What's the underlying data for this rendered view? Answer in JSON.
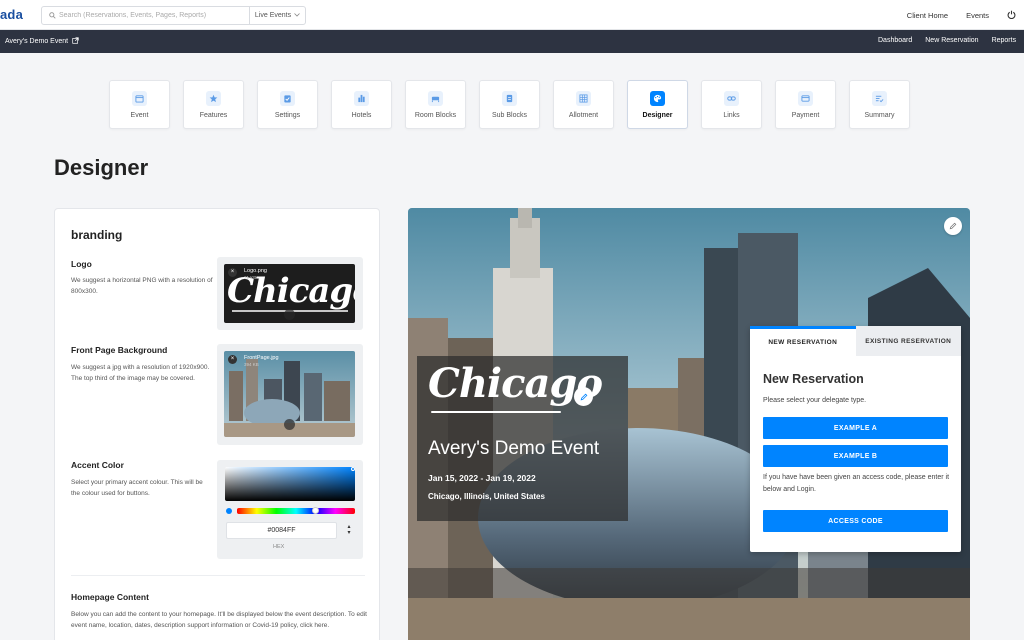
{
  "app": {
    "brand": "ada",
    "search_placeholder": "Search (Reservations, Events, Pages, Reports)",
    "search_scope": "Live Events",
    "top_links": [
      "Client Home",
      "Events"
    ]
  },
  "subbar": {
    "event_name": "Avery's Demo Event",
    "links": [
      "Dashboard",
      "New Reservation",
      "Reports"
    ]
  },
  "tabs": [
    {
      "label": "Event",
      "icon": "calendar-icon"
    },
    {
      "label": "Features",
      "icon": "star-icon"
    },
    {
      "label": "Settings",
      "icon": "clipboard-check-icon"
    },
    {
      "label": "Hotels",
      "icon": "building-icon"
    },
    {
      "label": "Room Blocks",
      "icon": "bed-icon"
    },
    {
      "label": "Sub Blocks",
      "icon": "document-icon"
    },
    {
      "label": "Allotment",
      "icon": "grid-icon"
    },
    {
      "label": "Designer",
      "icon": "palette-icon",
      "active": true
    },
    {
      "label": "Links",
      "icon": "link-icon"
    },
    {
      "label": "Payment",
      "icon": "credit-card-icon"
    },
    {
      "label": "Summary",
      "icon": "list-check-icon"
    }
  ],
  "page_title": "Designer",
  "branding": {
    "heading": "branding",
    "logo": {
      "title": "Logo",
      "desc": "We suggest a horizontal PNG with a resolution of 800x300.",
      "file_name": "Logo.png",
      "file_size": "21 KB"
    },
    "background": {
      "title": "Front Page Background",
      "desc": "We suggest a jpg with a resolution of 1920x900. The top third of the image may be covered.",
      "file_name": "FrontPage.jpg",
      "file_size": "394 KB"
    },
    "accent": {
      "title": "Accent Color",
      "desc": "Select your primary accent colour. This will be the colour used for buttons.",
      "hex_value": "#0084FF",
      "hex_label": "HEX",
      "color": "#0084FF"
    },
    "homepage": {
      "title": "Homepage Content",
      "desc": "Below you can add the content to your homepage. It'll be displayed below the event description. To edit event name, location, dates, description support information or Covid-19 policy, click here."
    }
  },
  "preview": {
    "logo_text": "Chicago",
    "event_title": "Avery's Demo Event",
    "dates": "Jan 15, 2022 - Jan 19, 2022",
    "location": "Chicago, Illinois, United States",
    "reservation": {
      "tab_new": "NEW RESERVATION",
      "tab_existing": "EXISTING RESERVATION",
      "heading": "New Reservation",
      "subtext": "Please select your delegate type.",
      "button_a": "EXAMPLE A",
      "button_b": "EXAMPLE B",
      "note": "If you have have been given an access code, please enter it below and Login.",
      "access_button": "ACCESS CODE"
    }
  }
}
